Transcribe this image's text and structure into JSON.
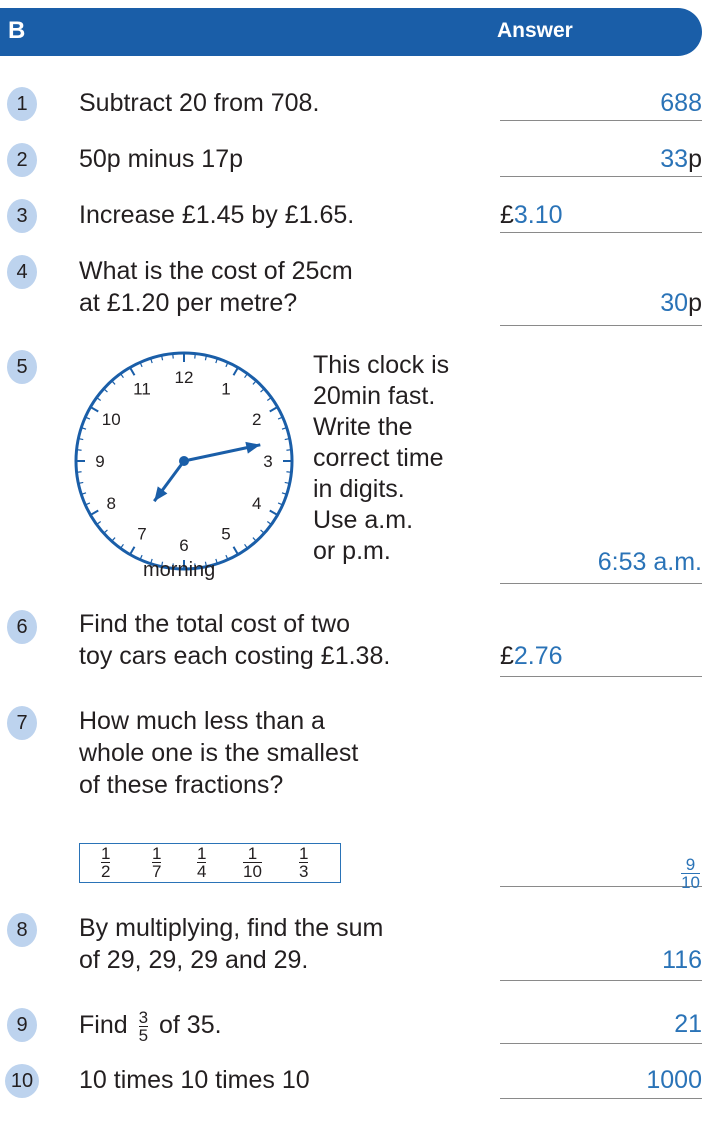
{
  "header": {
    "section": "B",
    "answer_label": "Answer"
  },
  "questions": [
    {
      "num": "1",
      "text": "Subtract 20 from 708.",
      "answer": "688"
    },
    {
      "num": "2",
      "text": "50p minus 17p",
      "answer": "33",
      "unit": "p"
    },
    {
      "num": "3",
      "text": "Increase £1.45 by £1.65.",
      "prefix": "£",
      "answer": "3.10"
    },
    {
      "num": "4",
      "line1": "What is the cost of 25cm",
      "line2": "at £1.20 per metre?",
      "answer": "30",
      "unit": "p"
    },
    {
      "num": "5",
      "lines": [
        "This clock is",
        "20min fast.",
        "Write the",
        "correct time",
        "in digits.",
        "Use a.m.",
        "or p.m."
      ],
      "clock_label": "morning",
      "clock_time": "7:13",
      "answer": "6:53 a.m."
    },
    {
      "num": "6",
      "line1": "Find the total cost of two",
      "line2": "toy cars each costing £1.38.",
      "prefix": "£",
      "answer": "2.76"
    },
    {
      "num": "7",
      "line1": "How much less than a",
      "line2": "whole one is the smallest",
      "line3": "of these fractions?",
      "fractions": [
        {
          "n": "1",
          "d": "2"
        },
        {
          "n": "1",
          "d": "7"
        },
        {
          "n": "1",
          "d": "4"
        },
        {
          "n": "1",
          "d": "10"
        },
        {
          "n": "1",
          "d": "3"
        }
      ],
      "answer_n": "9",
      "answer_d": "10"
    },
    {
      "num": "8",
      "line1": "By multiplying, find the sum",
      "line2": "of 29, 29, 29 and 29.",
      "answer": "116"
    },
    {
      "num": "9",
      "pre": "Find",
      "frac_n": "3",
      "frac_d": "5",
      "post": "of 35.",
      "answer": "21"
    },
    {
      "num": "10",
      "text": "10 times 10 times 10",
      "answer": "1000"
    }
  ],
  "clock_numbers": [
    "12",
    "1",
    "2",
    "3",
    "4",
    "5",
    "6",
    "7",
    "8",
    "9",
    "10",
    "11"
  ],
  "colors": {
    "header": "#1a5ea8",
    "number_circle": "#bdd3ee",
    "answer": "#2a73b7",
    "clock": "#1a5ea8"
  }
}
